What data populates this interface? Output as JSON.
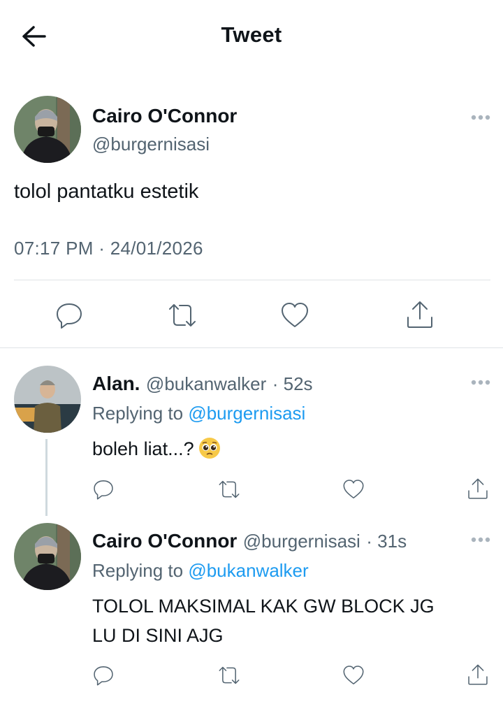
{
  "header": {
    "title": "Tweet"
  },
  "tweet": {
    "author_name": "Cairo O'Connor",
    "author_handle": "@burgernisasi",
    "text": "tolol pantatku estetik",
    "timestamp": "07:17 PM · 24/01/2026"
  },
  "replies": [
    {
      "author_name": "Alan.",
      "author_handle": "@bukanwalker",
      "time": "· 52s",
      "replying_label": "Replying to",
      "replying_to": "@burgernisasi",
      "text": "boleh liat...?",
      "emoji": "pleading-face-emoji"
    },
    {
      "author_name": "Cairo O'Connor",
      "author_handle": "@burgernisasi",
      "time": "· 31s",
      "replying_label": "Replying to",
      "replying_to": "@bukanwalker",
      "text_line1": "TOLOL MAKSIMAL KAK GW BLOCK JG",
      "text_line2": "LU DI SINI AJG"
    }
  ],
  "colors": {
    "text": "#0f1419",
    "secondary": "#536471",
    "accent": "#1d9bf0",
    "divider": "#dfe3e6"
  },
  "icons": [
    "back-arrow-icon",
    "more-icon",
    "reply-icon",
    "retweet-icon",
    "like-icon",
    "share-icon"
  ]
}
